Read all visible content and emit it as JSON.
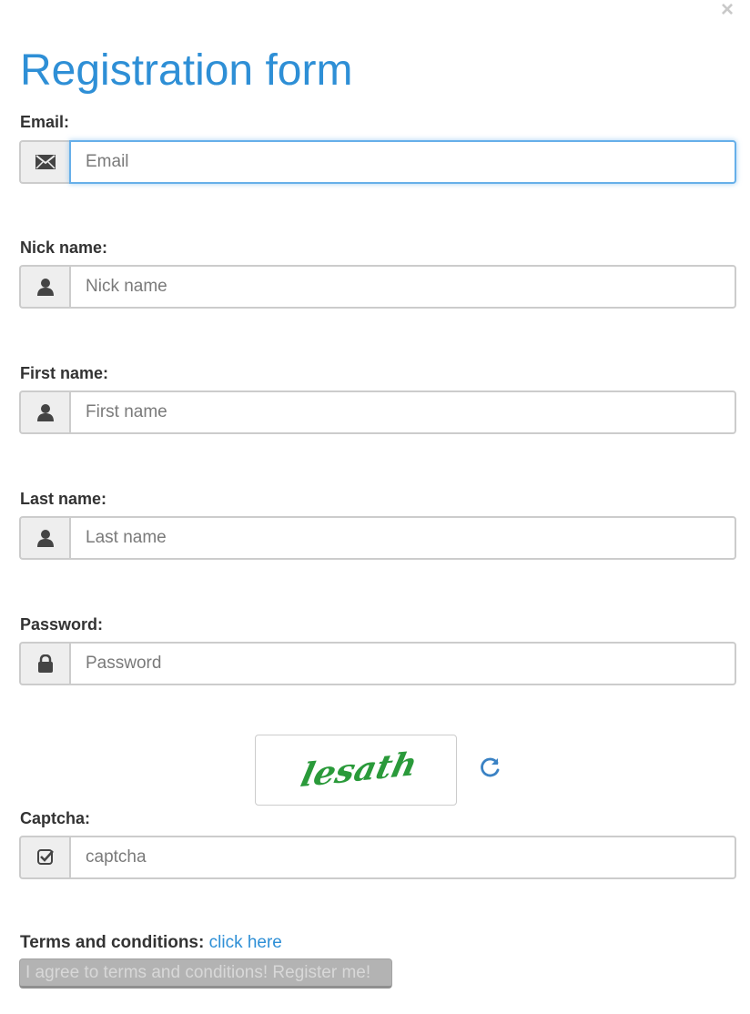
{
  "modal": {
    "close_label": "×",
    "title": "Registration form"
  },
  "fields": {
    "email": {
      "label": "Email:",
      "placeholder": "Email",
      "icon": "envelope-icon"
    },
    "nickname": {
      "label": "Nick name:",
      "placeholder": "Nick name",
      "icon": "user-icon"
    },
    "first_name": {
      "label": "First name:",
      "placeholder": "First name",
      "icon": "user-icon"
    },
    "last_name": {
      "label": "Last name:",
      "placeholder": "Last name",
      "icon": "user-icon"
    },
    "password": {
      "label": "Password:",
      "placeholder": "Password",
      "icon": "lock-icon"
    },
    "captcha": {
      "label": "Captcha:",
      "placeholder": "captcha",
      "icon": "check-icon"
    }
  },
  "captcha_image": {
    "text": "lesath",
    "color": "#2a9a3a",
    "refresh_icon": "refresh-icon"
  },
  "terms": {
    "label": "Terms and conditions:",
    "link_text": "click here"
  },
  "register_button": {
    "label": "I agree to terms and conditions! Register me!"
  },
  "colors": {
    "accent": "#2e8fd6",
    "focus_border": "#66afe9",
    "disabled_button": "#b3b3b3"
  }
}
